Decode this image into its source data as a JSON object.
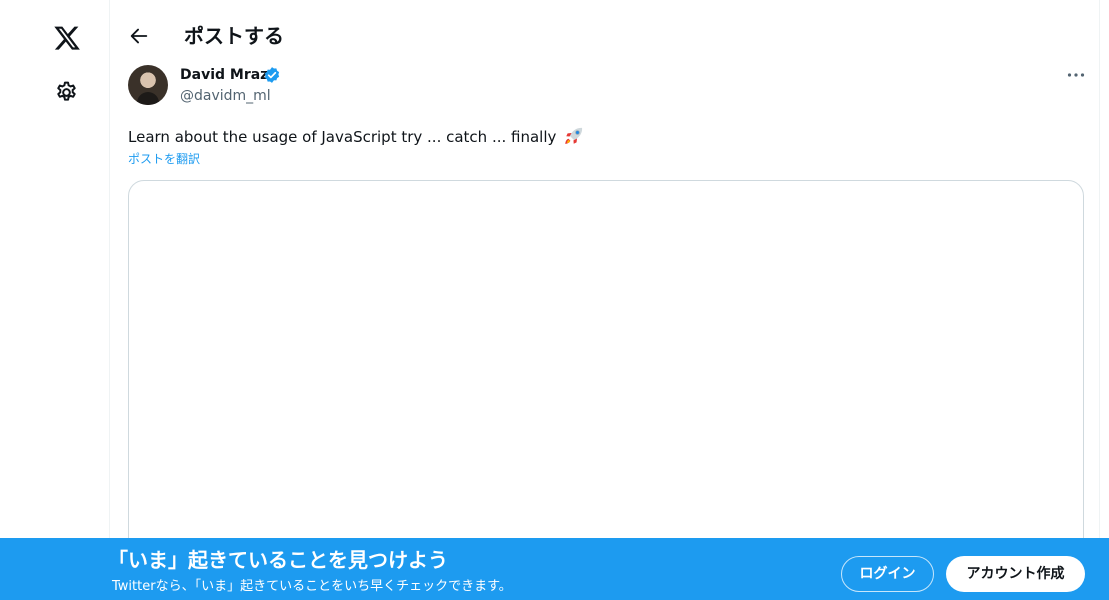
{
  "nav": {
    "logo_icon": "x-logo-icon",
    "settings_icon": "gear-icon"
  },
  "header": {
    "back_icon": "arrow-left-icon",
    "title": "ポストする"
  },
  "post": {
    "author": {
      "display_name": "David Mraz",
      "verified": true,
      "handle": "@davidm_ml"
    },
    "more_icon": "more-horizontal-icon",
    "text": "Learn about the usage of JavaScript try ... catch ... finally",
    "emoji": "rocket",
    "translate_label": "ポストを翻訳"
  },
  "promo": {
    "title": "「いま」起きていることを見つけよう",
    "subtitle": "Twitterなら、「いま」起きていることをいち早くチェックできます。",
    "login_label": "ログイン",
    "signup_label": "アカウント作成"
  },
  "colors": {
    "accent": "#1d9bf0",
    "text": "#0f1419",
    "muted": "#536471",
    "border": "#cfd9de"
  }
}
